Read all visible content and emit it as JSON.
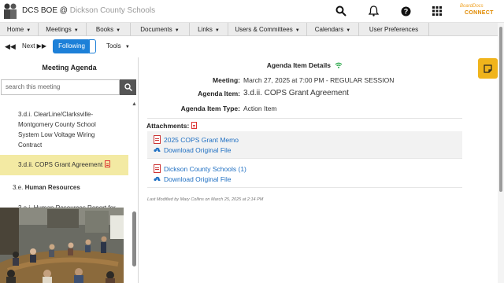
{
  "header": {
    "app_name": "DCS BOE @",
    "org_name": "Dickson County Schools",
    "connect_small": "BoardDocs",
    "connect_big": "CONNECT",
    "icons": [
      "search-icon",
      "bell-icon",
      "help-icon",
      "apps-grid-icon"
    ]
  },
  "menu": {
    "items": [
      {
        "label": "Home",
        "caret": "▼"
      },
      {
        "label": "Meetings",
        "caret": "▼"
      },
      {
        "label": "Books",
        "caret": "▼"
      },
      {
        "label": "Documents",
        "caret": "▼"
      },
      {
        "label": "Links",
        "caret": "▼"
      },
      {
        "label": "Users & Committees",
        "caret": "▼"
      },
      {
        "label": "Calendars",
        "caret": "▼"
      },
      {
        "label": "User Preferences",
        "caret": ""
      }
    ]
  },
  "toolbar": {
    "prev": "◀◀",
    "next": "Next ▶▶",
    "following": "Following",
    "tools": "Tools",
    "tools_caret": "▼"
  },
  "sidebar": {
    "heading": "Meeting Agenda",
    "search_placeholder": "search this meeting",
    "items": [
      {
        "label": "3.d.i. ClearLine/Clarksville-Montgomery County School System Low Voltage Wiring Contract"
      },
      {
        "label": "3.d.ii. COPS Grant Agreement"
      },
      {
        "number": "3.e.",
        "label": "Human Resources"
      },
      {
        "label": "3.e.i. Human Resources Report for..."
      }
    ]
  },
  "details": {
    "title": "Agenda Item Details",
    "meeting_label": "Meeting:",
    "meeting_value": "March 27, 2025 at 7:00 PM - REGULAR SESSION",
    "item_label": "Agenda Item:",
    "item_value": "3.d.ii. COPS Grant Agreement",
    "type_label": "Agenda Item Type:",
    "type_value": "Action Item",
    "attachments_label": "Attachments:",
    "attachments": [
      {
        "name": "2025 COPS Grant Memo",
        "download": "Download Original File"
      },
      {
        "name": "Dickson County Schools (1)",
        "download": "Download Original File"
      }
    ],
    "modified": "Last Modified by Mary Collins on March 25, 2025 at 2:14 PM"
  },
  "colors": {
    "accent_blue": "#1d80d8",
    "selected_item": "#f3eaa3",
    "sticky_note": "#f0b41c",
    "link": "#1d6ec2"
  }
}
